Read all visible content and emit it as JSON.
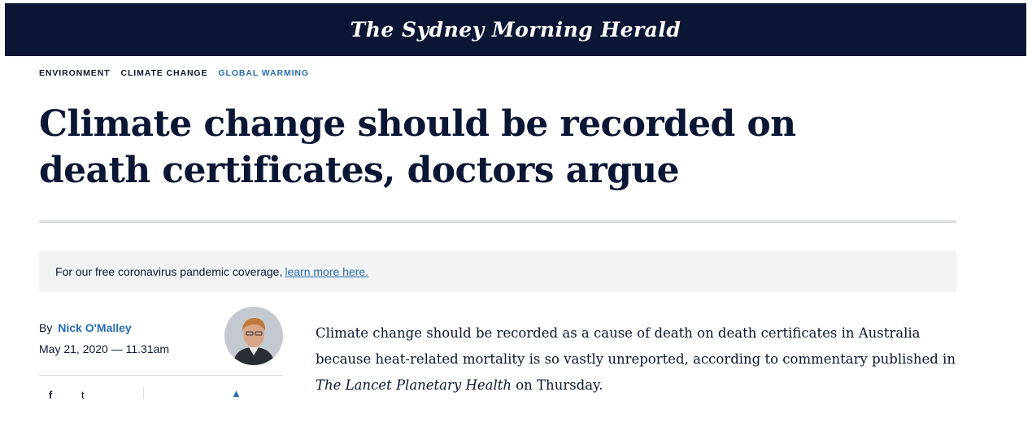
{
  "masthead": {
    "logo_text": "The Sydney Morning Herald"
  },
  "breadcrumb": [
    {
      "label": "ENVIRONMENT"
    },
    {
      "label": "CLIMATE CHANGE"
    },
    {
      "label": "GLOBAL WARMING"
    }
  ],
  "article": {
    "headline": "Climate change should be recorded on death certificates, doctors argue",
    "promo": {
      "text": "For our free coronavirus pandemic coverage,",
      "link": "learn more here."
    },
    "byline": {
      "prefix": "By",
      "author": "Nick O'Malley",
      "date": "May 21, 2020 — 11.31am"
    },
    "body": {
      "lead": "Climate change should be recorded as a cause of death on death certificates in Australia because heat-related mortality is so vastly unreported, according to commentary published in",
      "source": "The Lancet Planetary Health",
      "tail": "on Thursday."
    }
  },
  "icons": {
    "facebook": "facebook-icon",
    "twitter": "twitter-icon",
    "bookmark": "bookmark-icon"
  },
  "colors": {
    "navy": "#0a1633",
    "link_blue": "#2a6bb4",
    "promo_bg": "#f2f3f5",
    "divider": "#d9dde2"
  }
}
